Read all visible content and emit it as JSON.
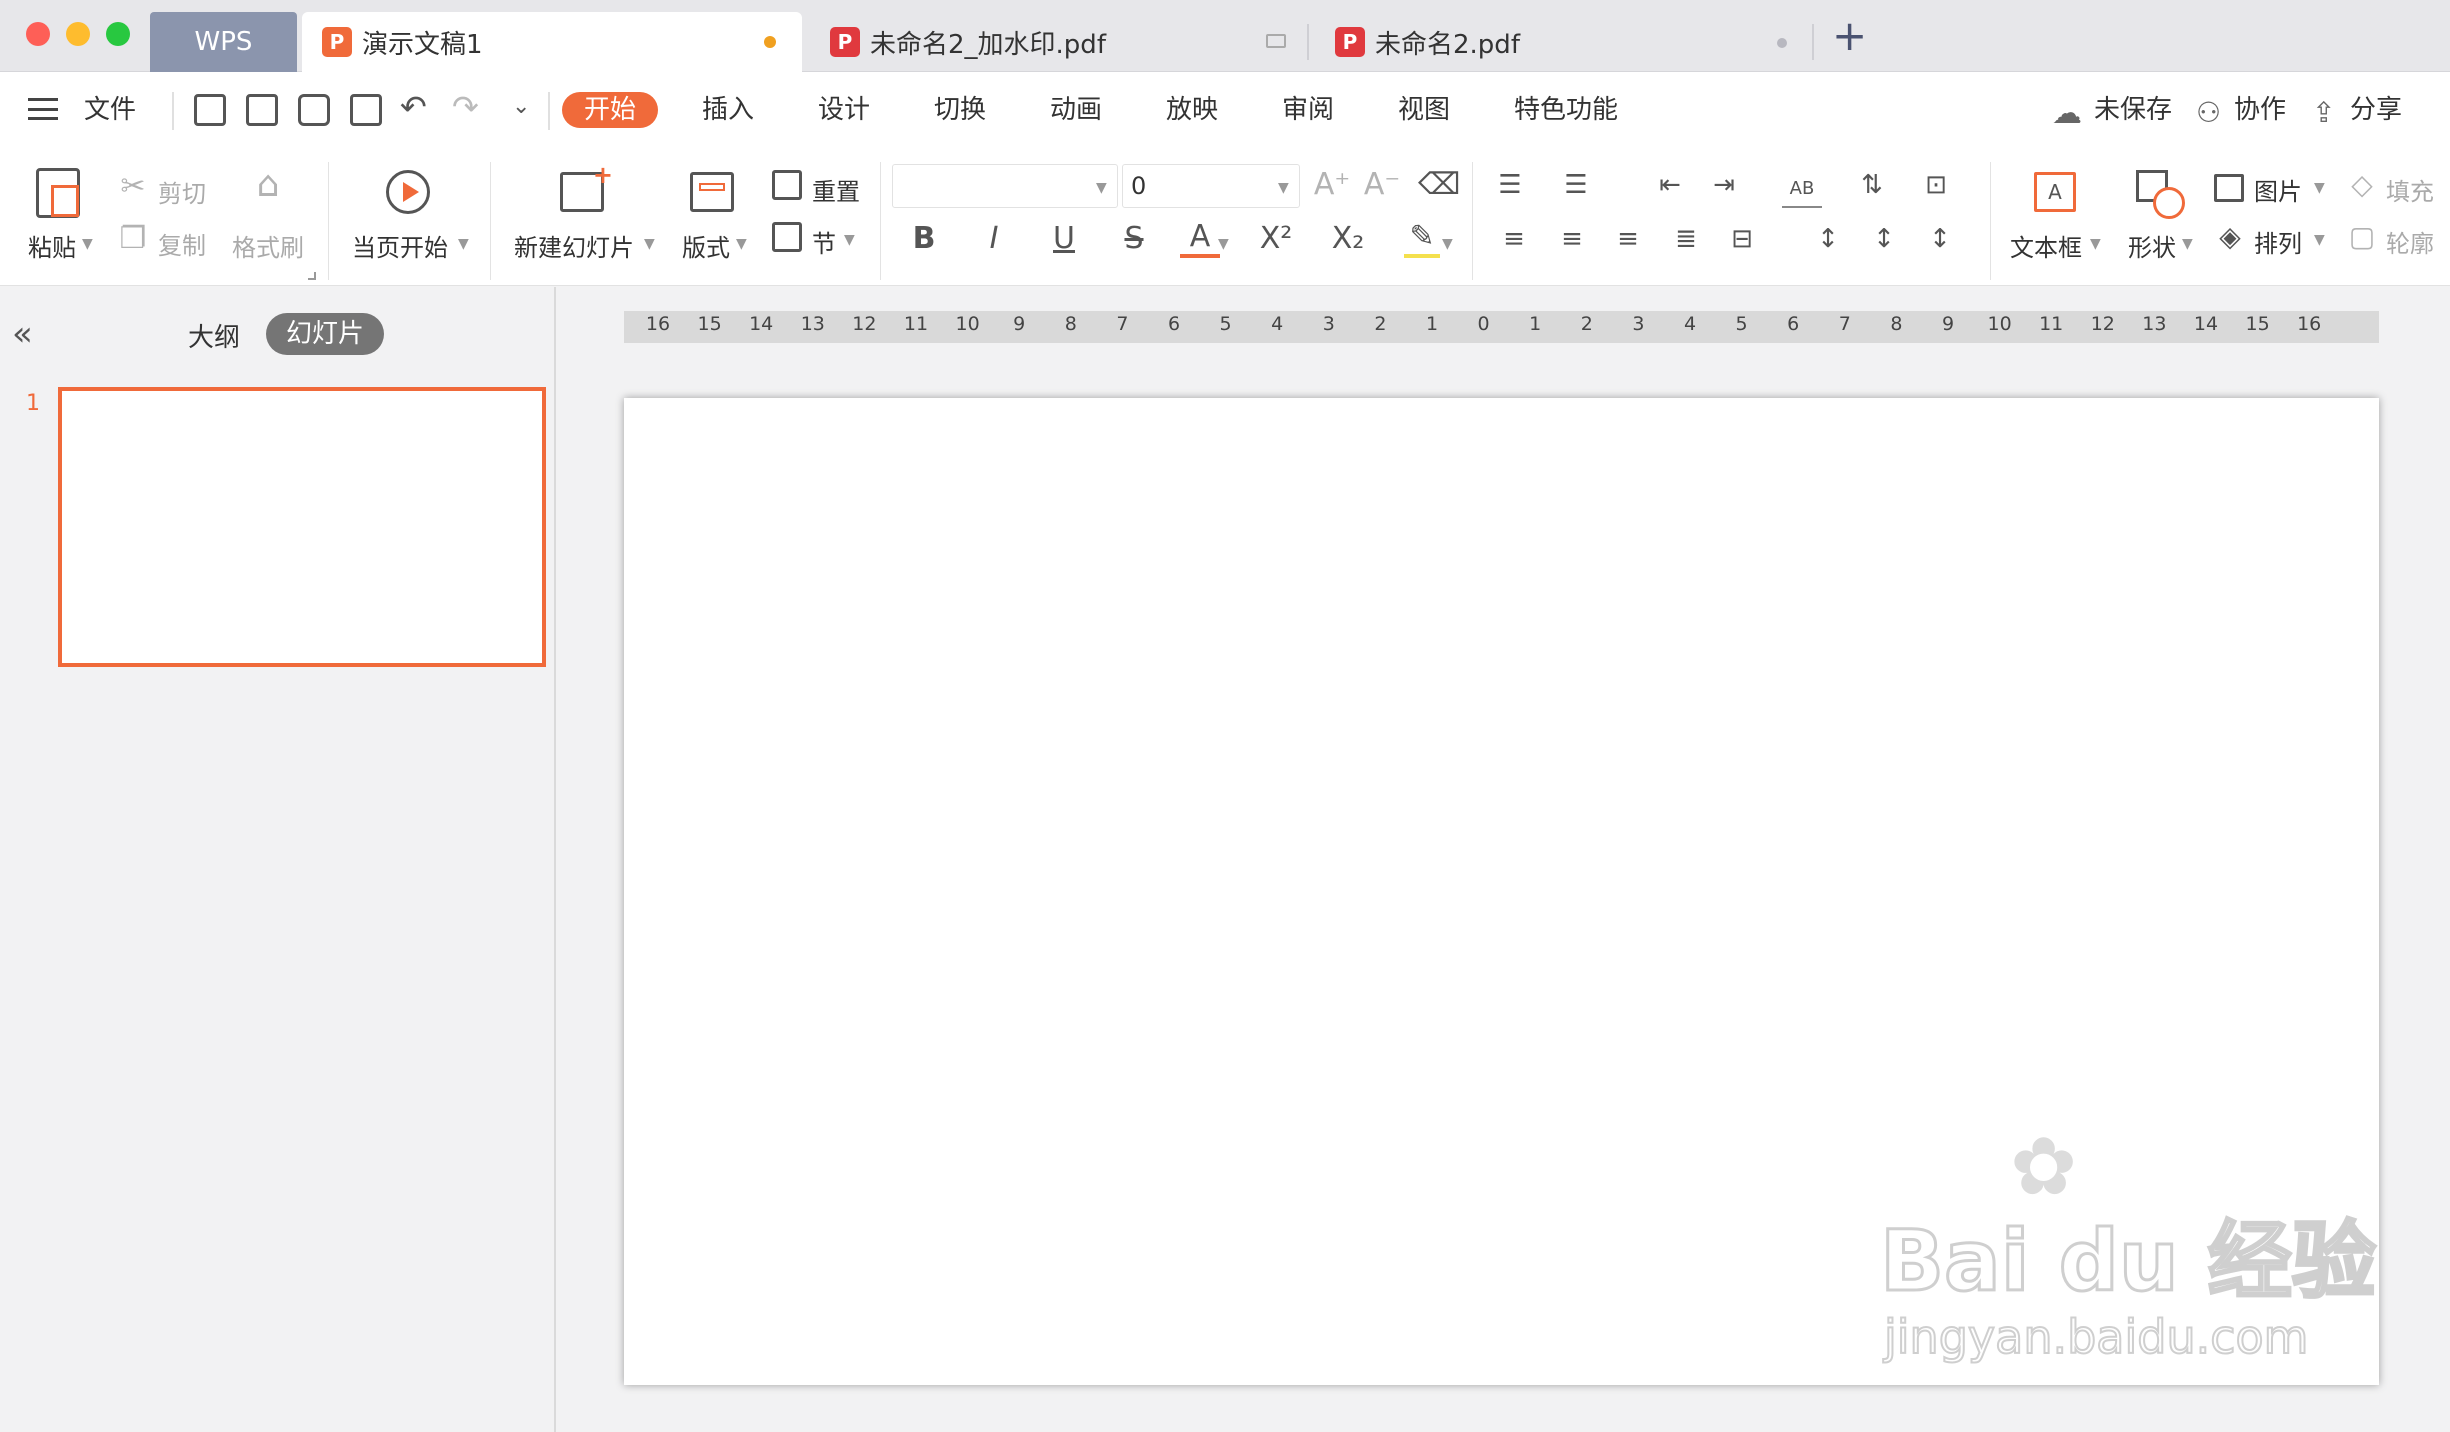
{
  "window": {
    "tabs": [
      {
        "label": "WPS"
      },
      {
        "label": "演示文稿1"
      },
      {
        "label": "未命名2_加水印.pdf"
      },
      {
        "label": "未命名2.pdf"
      }
    ],
    "new_tab_symbol": "+"
  },
  "menu": {
    "file_label": "文件",
    "tabs": [
      "开始",
      "插入",
      "设计",
      "切换",
      "动画",
      "放映",
      "审阅",
      "视图",
      "特色功能"
    ],
    "active_tab": "开始",
    "right_actions": {
      "unsaved": "未保存",
      "collaborate": "协作",
      "share": "分享"
    }
  },
  "toolbar": {
    "paste": "粘贴",
    "cut": "剪切",
    "copy": "复制",
    "format_painter": "格式刷",
    "play_from_current": "当页开始",
    "new_slide": "新建幻灯片",
    "layout": "版式",
    "reset": "重置",
    "section": "节",
    "font_name": "",
    "font_size": "0",
    "textbox": "文本框",
    "shape": "形状",
    "picture": "图片",
    "arrange": "排列",
    "fill": "填充",
    "outline": "轮廓"
  },
  "left_panel": {
    "outline_tab": "大纲",
    "slides_tab": "幻灯片",
    "slide_number": "1"
  },
  "ruler": {
    "ticks": [
      "16",
      "15",
      "14",
      "13",
      "12",
      "11",
      "10",
      "9",
      "8",
      "7",
      "6",
      "5",
      "4",
      "3",
      "2",
      "1",
      "0",
      "1",
      "2",
      "3",
      "4",
      "5",
      "6",
      "7",
      "8",
      "9",
      "10",
      "11",
      "12",
      "13",
      "14",
      "15",
      "16"
    ]
  },
  "watermark": {
    "brand": "Bai  du 经验",
    "url": "jingyan.baidu.com"
  },
  "colors": {
    "accent": "#f06a3a",
    "wps_tab": "#8b95ad",
    "pdf_icon": "#e0393e"
  }
}
